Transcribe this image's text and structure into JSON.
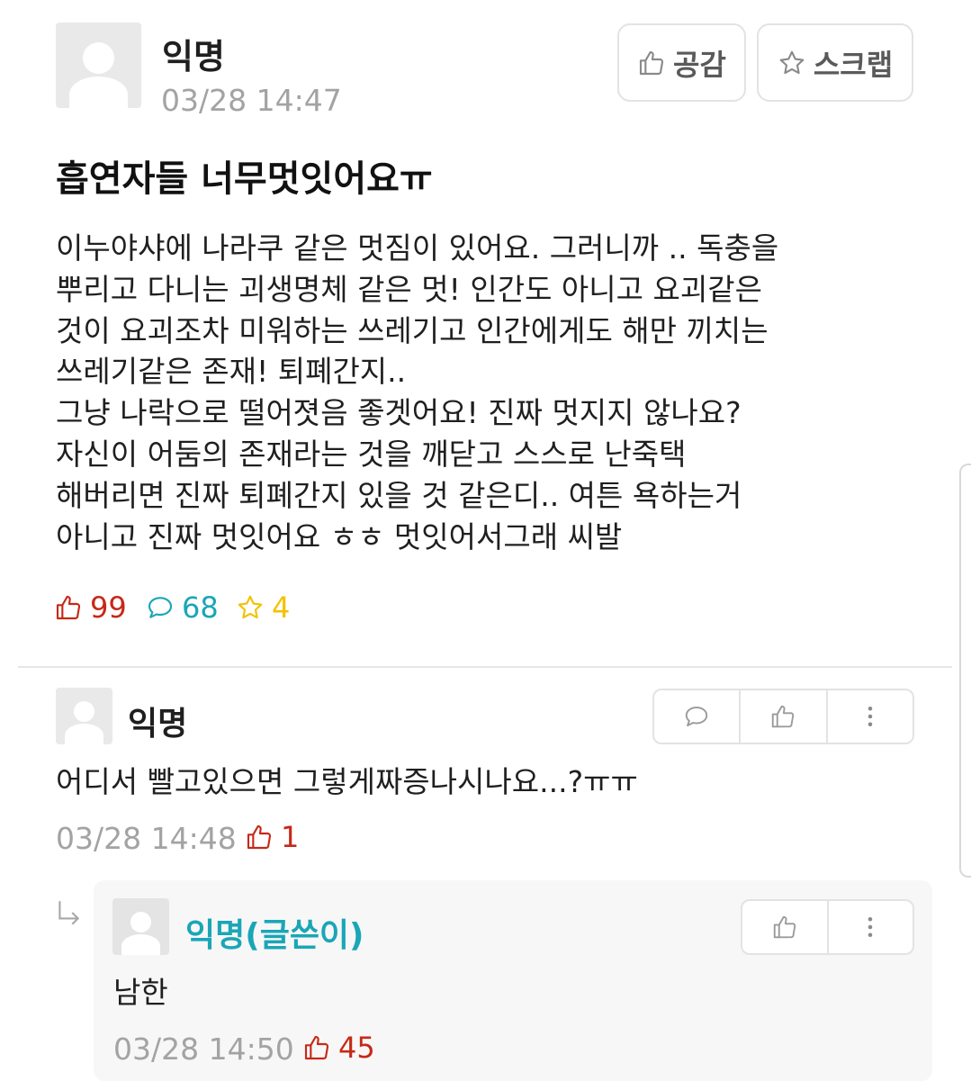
{
  "post": {
    "author": "익명",
    "time": "03/28 14:47",
    "like_button_label": "공감",
    "scrap_button_label": "스크랩",
    "title": "흡연자들 너무멋잇어요ㅠ",
    "body_lines": [
      "이누야샤에 나라쿠 같은 멋짐이 있어요. 그러니까 .. 독충을",
      "뿌리고 다니는 괴생명체 같은 멋! 인간도 아니고 요괴같은",
      "것이 요괴조차 미워하는 쓰레기고 인간에게도 해만 끼치는",
      "쓰레기같은 존재! 퇴폐간지..",
      "그냥 나락으로 떨어졋음 좋겟어요! 진짜 멋지지 않나요?",
      "자신이 어둠의 존재라는 것을 깨닫고 스스로 난죽택",
      "해버리면 진짜 퇴폐간지 있을 것 같은디.. 여튼 욕하는거",
      "아니고 진짜 멋잇어요 ㅎㅎ 멋잇어서그래 씨발"
    ],
    "stats": {
      "likes": "99",
      "comments": "68",
      "scraps": "4"
    }
  },
  "comment": {
    "author": "익명",
    "text": "어디서 빨고있으면 그렇게짜증나시나요...?ㅠㅠ",
    "time": "03/28 14:48",
    "likes": "1"
  },
  "reply": {
    "author": "익명(글쓴이)",
    "text": "남한",
    "time": "03/28 14:50",
    "likes": "45"
  },
  "icons": {
    "thumb": "thumbs-up-icon",
    "star": "star-icon",
    "comment": "comment-bubble-icon",
    "more": "more-vertical-icon",
    "reply_arrow": "reply-arrow-icon",
    "avatar": "default-avatar-icon"
  },
  "colors": {
    "like_red": "#c62917",
    "comment_teal": "#1aa6b7",
    "scrap_yellow": "#f2c200",
    "op_author_teal": "#1aa6b7",
    "time_gray": "#a3a3a3"
  }
}
